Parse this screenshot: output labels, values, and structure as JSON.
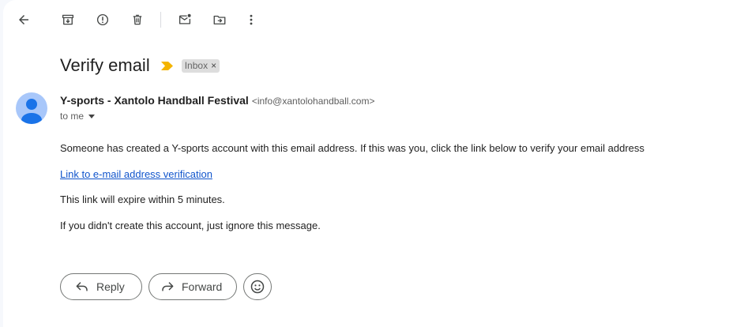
{
  "toolbar": {
    "icons": [
      "back-arrow-icon",
      "archive-icon",
      "report-spam-icon",
      "delete-icon",
      "mark-unread-icon",
      "move-to-icon",
      "more-vert-icon"
    ]
  },
  "email": {
    "subject": "Verify email",
    "label": "Inbox",
    "label_remove": "×",
    "sender_name": "Y-sports - Xantolo Handball Festival",
    "sender_email": "<info@xantolohandball.com>",
    "recipient": "to me",
    "body": {
      "line1": "Someone has created a Y-sports account with this email address. If this was you, click the link below to verify your email address",
      "link": "Link to e-mail address verification",
      "line2": "This link will expire within 5 minutes.",
      "line3": "If you didn't create this account, just ignore this message."
    }
  },
  "actions": {
    "reply": "Reply",
    "forward": "Forward"
  },
  "colors": {
    "link": "#1155cc",
    "importance": "#f4b400",
    "avatar_bg": "#a8c7fa",
    "avatar_fg": "#1a73e8"
  }
}
